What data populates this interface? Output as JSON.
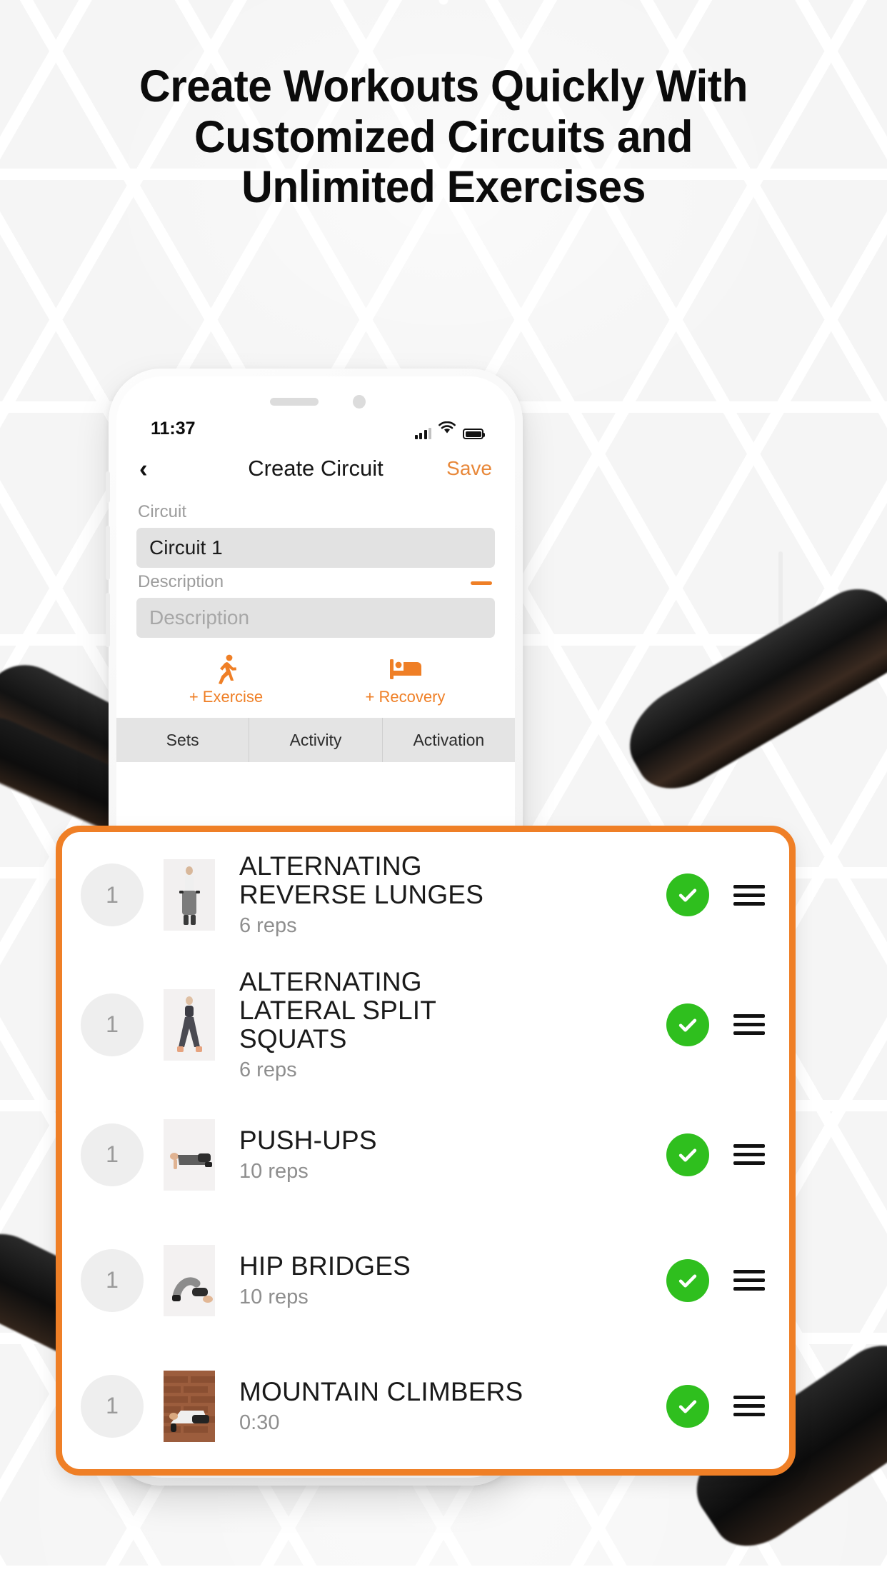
{
  "headline": {
    "line1": "Create Workouts Quickly With",
    "line2": "Customized Circuits and",
    "line3": "Unlimited Exercises"
  },
  "colors": {
    "accent_orange": "#ef7f26",
    "save_orange": "#e8883a",
    "check_green": "#2fbf1e",
    "field_gray": "#e2e2e2",
    "background": "#f5f5f5"
  },
  "phone": {
    "status_bar": {
      "time": "11:37",
      "signal_icon": "cellular-signal-icon",
      "wifi_icon": "wifi-icon",
      "battery_icon": "battery-full-icon"
    },
    "nav_bar": {
      "back_icon": "chevron-left-icon",
      "title": "Create Circuit",
      "save_label": "Save"
    },
    "form": {
      "circuit_label": "Circuit",
      "circuit_value": "Circuit 1",
      "circuit_placeholder": "Circuit",
      "description_label": "Description",
      "description_value": "",
      "description_placeholder": "Description",
      "collapse_icon": "minus-icon"
    },
    "actions": [
      {
        "icon": "running-person-icon",
        "label": "+ Exercise"
      },
      {
        "icon": "bed-recovery-icon",
        "label": "+ Recovery"
      }
    ],
    "tabs": [
      {
        "label": "Sets"
      },
      {
        "label": "Activity"
      },
      {
        "label": "Activation"
      }
    ],
    "home_indicator": "home-indicator"
  },
  "exercise_card": {
    "rows": [
      {
        "badge": "1",
        "title": "ALTERNATING REVERSE LUNGES",
        "subtitle": "6 reps",
        "thumb": "woman-holding-dumbbells-standing",
        "status_icon": "green-check-icon",
        "handle_icon": "drag-handle-icon"
      },
      {
        "badge": "1",
        "title": "ALTERNATING LATERAL SPLIT SQUATS",
        "subtitle": "6 reps",
        "thumb": "woman-standing-wide-stance",
        "status_icon": "green-check-icon",
        "handle_icon": "drag-handle-icon"
      },
      {
        "badge": "1",
        "title": "PUSH-UPS",
        "subtitle": "10 reps",
        "thumb": "person-in-push-up-position",
        "status_icon": "green-check-icon",
        "handle_icon": "drag-handle-icon"
      },
      {
        "badge": "1",
        "title": "HIP BRIDGES",
        "subtitle": "10 reps",
        "thumb": "person-lying-hip-bridge",
        "status_icon": "green-check-icon",
        "handle_icon": "drag-handle-icon"
      },
      {
        "badge": "1",
        "title": "MOUNTAIN CLIMBERS",
        "subtitle": "0:30",
        "thumb": "person-mountain-climber-brick-wall",
        "status_icon": "green-check-icon",
        "handle_icon": "drag-handle-icon"
      }
    ]
  }
}
